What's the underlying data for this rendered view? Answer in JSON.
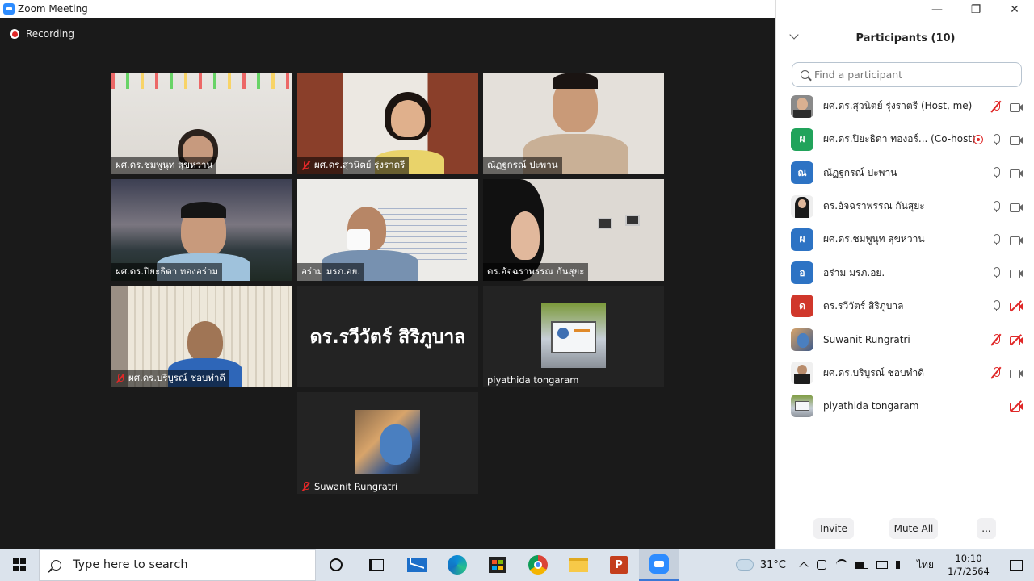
{
  "window": {
    "title": "Zoom Meeting"
  },
  "recording_label": "Recording",
  "tiles": [
    {
      "name": "ผศ.ดร.ชมพูนุท  สุขหวาน",
      "muted": false
    },
    {
      "name": "ผศ.ดร.สุวนิตย์ รุ่งราตรี",
      "muted": true
    },
    {
      "name": "ณัฏฐกรณ์ ปะพาน",
      "muted": false
    },
    {
      "name": "ผศ.ดร.ปิยะธิดา ทองอร่าม",
      "muted": false
    },
    {
      "name": "อร่าม มรภ.อย.",
      "muted": false
    },
    {
      "name": "ดร.อัจฉราพรรณ กันสุยะ",
      "muted": false
    },
    {
      "name": "ผศ.ดร.บริบูรณ์ ชอบทำดี",
      "muted": true
    },
    {
      "name": "ดร.รวีวัตร์ สิริภูบาล",
      "muted": false
    },
    {
      "name": "piyathida tongaram",
      "muted": false
    },
    {
      "name": "Suwanit Rungratri",
      "muted": true
    }
  ],
  "panel": {
    "title": "Participants (10)",
    "search_placeholder": "Find a participant",
    "participants": [
      {
        "name": "ผศ.ดร.สุวนิตย์ รุ่งราตรี (Host, me)",
        "avatar": "photo",
        "color": "#8a8a8a",
        "mic": "off",
        "cam": "on"
      },
      {
        "name": "ผศ.ดร.ปิยะธิดา ทองอร์... (Co-host)",
        "avatar": "ผ",
        "color": "#21a35b",
        "mic": "on",
        "cam": "on",
        "recording": true
      },
      {
        "name": "ณัฏฐกรณ์ ปะพาน",
        "avatar": "ณ",
        "color": "#2d73c4",
        "mic": "on",
        "cam": "on"
      },
      {
        "name": "ดร.อัจฉราพรรณ กันสุยะ",
        "avatar": "photo",
        "color": "#d9d9d9",
        "mic": "on",
        "cam": "on"
      },
      {
        "name": "ผศ.ดร.ชมพูนุท  สุขหวาน",
        "avatar": "ผ",
        "color": "#2d73c4",
        "mic": "on",
        "cam": "on"
      },
      {
        "name": "อร่าม มรภ.อย.",
        "avatar": "อ",
        "color": "#2d73c4",
        "mic": "on",
        "cam": "on"
      },
      {
        "name": "ดร.รวีวัตร์ สิริภูบาล",
        "avatar": "ด",
        "color": "#d0372b",
        "mic": "on",
        "cam": "off"
      },
      {
        "name": "Suwanit Rungratri",
        "avatar": "photo",
        "color": "#9aa9bd",
        "mic": "off",
        "cam": "off"
      },
      {
        "name": "ผศ.ดร.บริบูรณ์ ชอบทำดี",
        "avatar": "photo",
        "color": "#444444",
        "mic": "off",
        "cam": "on"
      },
      {
        "name": "piyathida tongaram",
        "avatar": "photo",
        "color": "#9a9a9a",
        "mic": "none",
        "cam": "off"
      }
    ],
    "buttons": {
      "invite": "Invite",
      "mute_all": "Mute All",
      "more": "..."
    }
  },
  "taskbar": {
    "search_placeholder": "Type here to search",
    "temperature": "31°C",
    "language": "ไทย",
    "time": "10:10",
    "date": "1/7/2564"
  }
}
